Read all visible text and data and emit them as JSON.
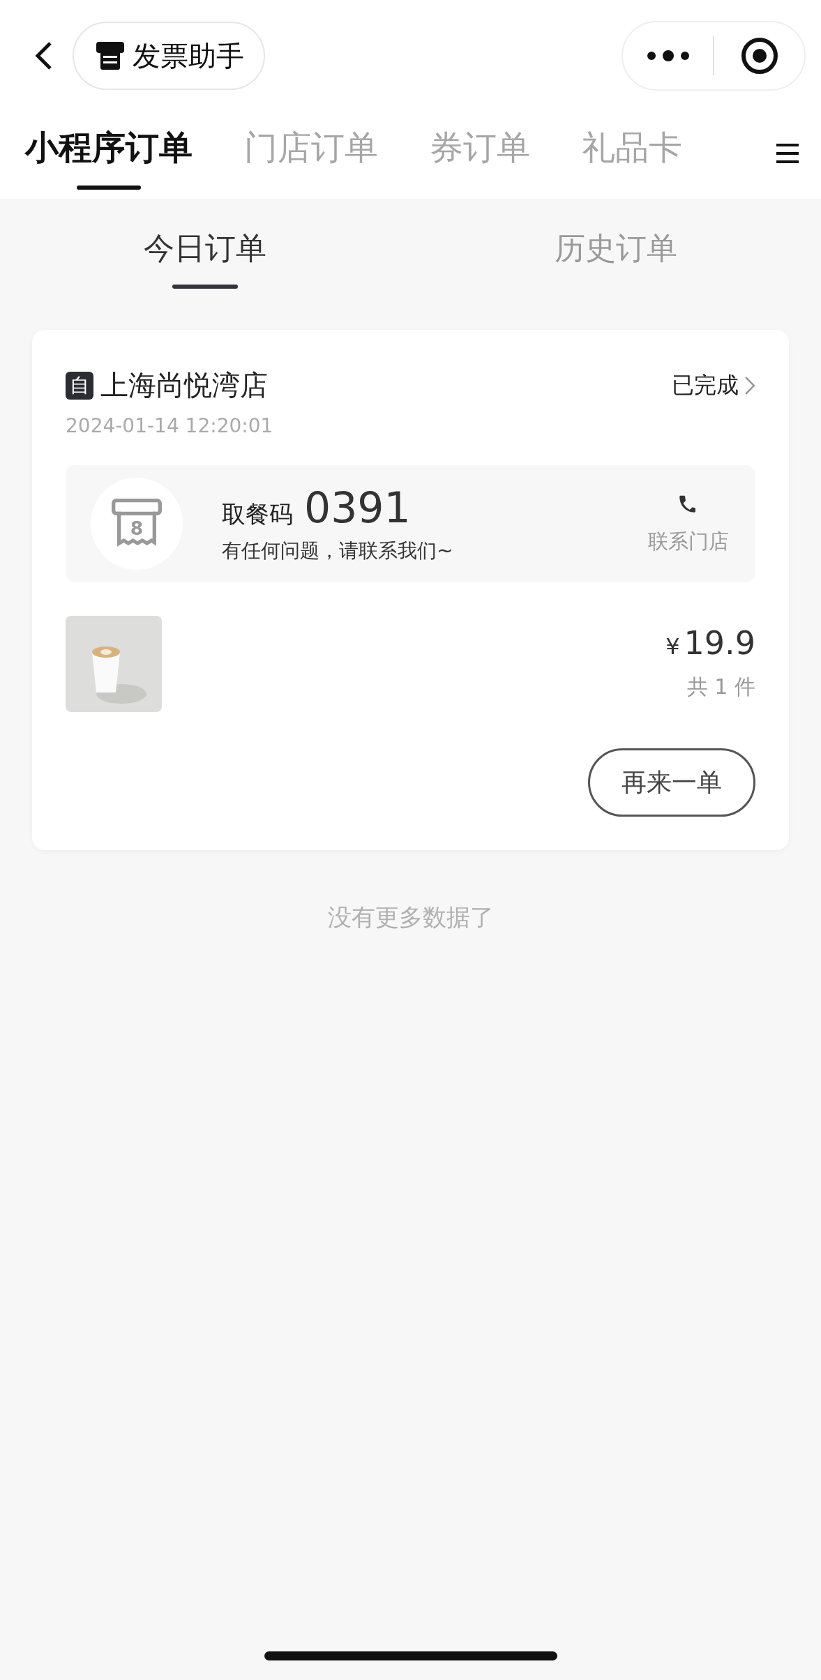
{
  "nav": {
    "invoice_button": "发票助手"
  },
  "tabs": [
    {
      "label": "小程序订单",
      "selected": true
    },
    {
      "label": "门店订单",
      "selected": false
    },
    {
      "label": "券订单",
      "selected": false
    },
    {
      "label": "礼品卡",
      "selected": false
    }
  ],
  "subtabs": [
    {
      "label": "今日订单",
      "selected": true
    },
    {
      "label": "历史订单",
      "selected": false
    }
  ],
  "orders": [
    {
      "badge": "自",
      "store": "上海尚悦湾店",
      "status": "已完成",
      "time": "2024-01-14 12:20:01",
      "pickup_label": "取餐码",
      "pickup_code": "0391",
      "help": "有任何问题，请联系我们~",
      "ticket_number": "8",
      "contact": "联系门店",
      "price_symbol": "¥",
      "price": "19.9",
      "count": "共 1 件",
      "reorder": "再来一单"
    }
  ],
  "footer": "没有更多数据了"
}
